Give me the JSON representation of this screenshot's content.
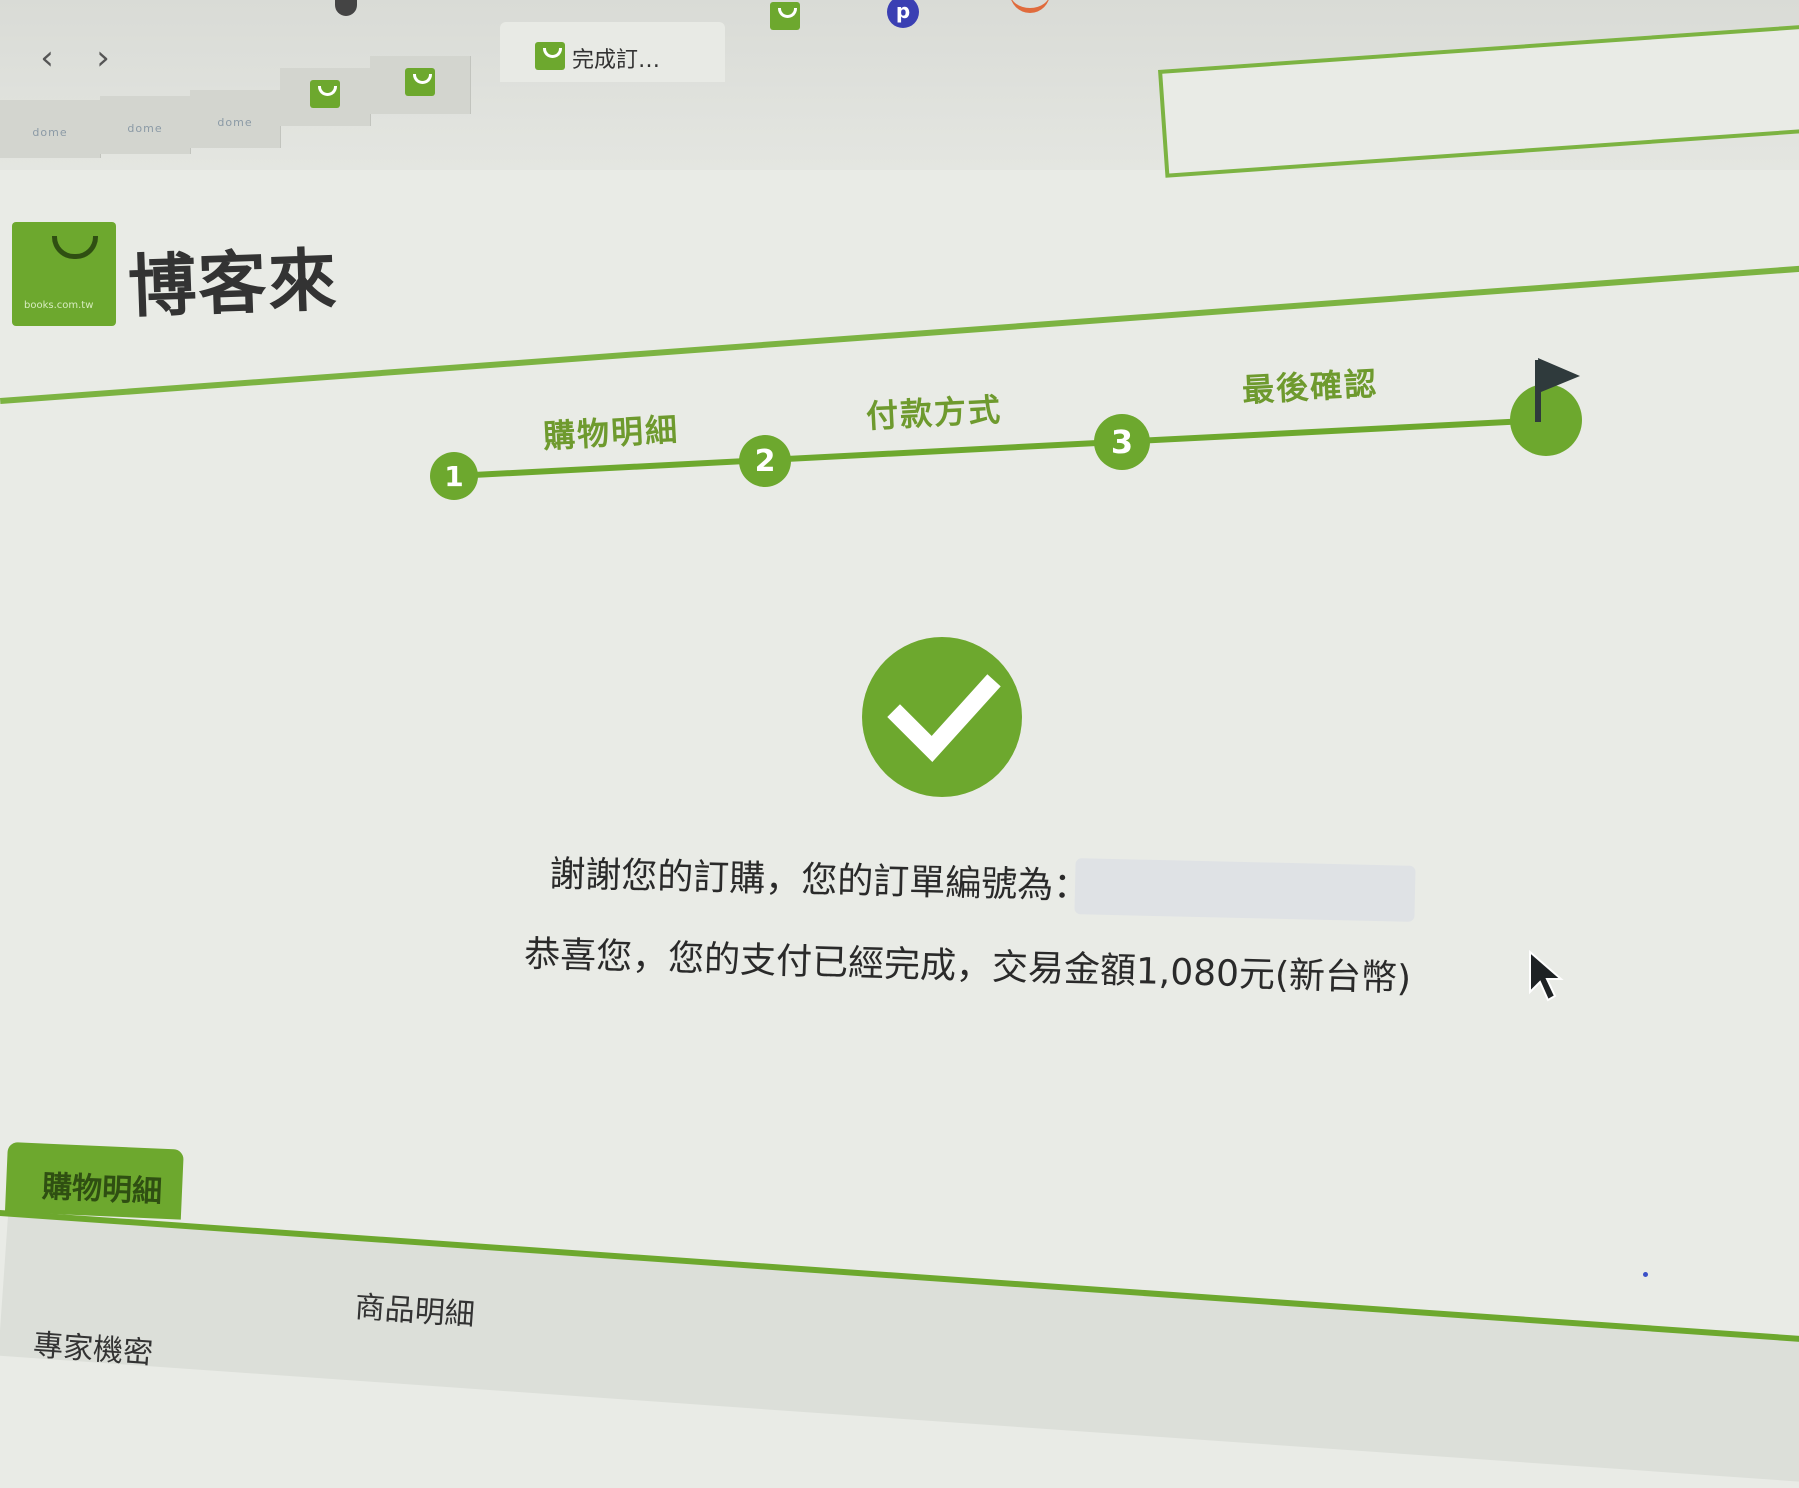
{
  "browser": {
    "active_tab_title": "完成訂…",
    "pinned_icon_letter": "p",
    "tab_favicon_text": "dome"
  },
  "header": {
    "brand_name": "博客來",
    "logo_domain": "books.com.tw"
  },
  "steps": [
    {
      "number": "1",
      "label": "購物明細"
    },
    {
      "number": "2",
      "label": "付款方式"
    },
    {
      "number": "3",
      "label": "最後確認"
    }
  ],
  "confirmation": {
    "order_message": "謝謝您的訂購，您的訂單編號為：",
    "payment_message": "恭喜您，您的支付已經完成，交易金額1,080元(新台幣)"
  },
  "details": {
    "tab_label": "購物明細",
    "column_header": "商品明細",
    "first_row_text": "專家機密"
  },
  "colors": {
    "brand_green": "#6da82e",
    "line_green": "#7cb342",
    "flag": "#2f3a3c"
  }
}
